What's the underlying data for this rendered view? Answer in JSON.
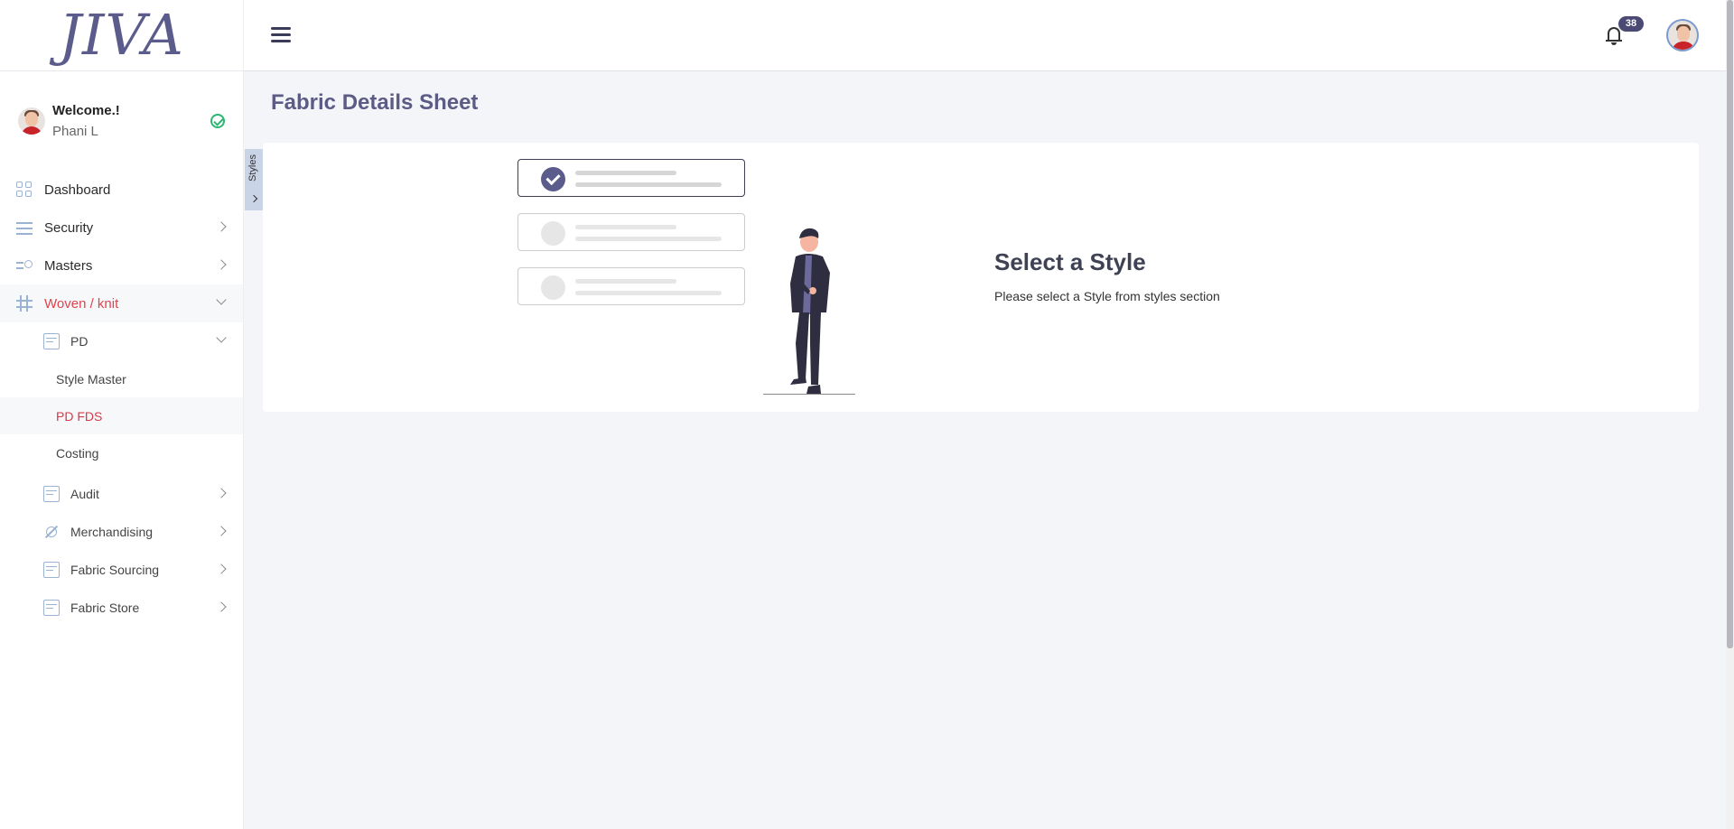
{
  "app": {
    "logo_text": "JIVA"
  },
  "header": {
    "notification_count": "38"
  },
  "user": {
    "welcome": "Welcome.!",
    "name": "Phani L"
  },
  "sidebar": {
    "items": [
      {
        "label": "Dashboard",
        "icon": "grid-icon"
      },
      {
        "label": "Security",
        "icon": "sliders-icon"
      },
      {
        "label": "Masters",
        "icon": "search-list-icon"
      },
      {
        "label": "Woven / knit",
        "icon": "hash-icon",
        "expanded": true
      },
      {
        "label": "PD",
        "icon": "table-icon",
        "expanded": true
      },
      {
        "label": "Style Master"
      },
      {
        "label": "PD FDS",
        "current": true
      },
      {
        "label": "Costing"
      },
      {
        "label": "Audit",
        "icon": "box-icon"
      },
      {
        "label": "Merchandising",
        "icon": "network-icon"
      },
      {
        "label": "Fabric Sourcing",
        "icon": "document-icon"
      },
      {
        "label": "Fabric Store",
        "icon": "document-icon"
      }
    ]
  },
  "styles_panel": {
    "label": "Styles"
  },
  "page": {
    "title": "Fabric Details Sheet",
    "empty_title": "Select a Style",
    "empty_subtitle": "Please select a Style from styles section"
  },
  "colors": {
    "accent": "#5d5a86",
    "active_red": "#e0434d",
    "badge": "#4b4a75",
    "success": "#2bb673"
  }
}
